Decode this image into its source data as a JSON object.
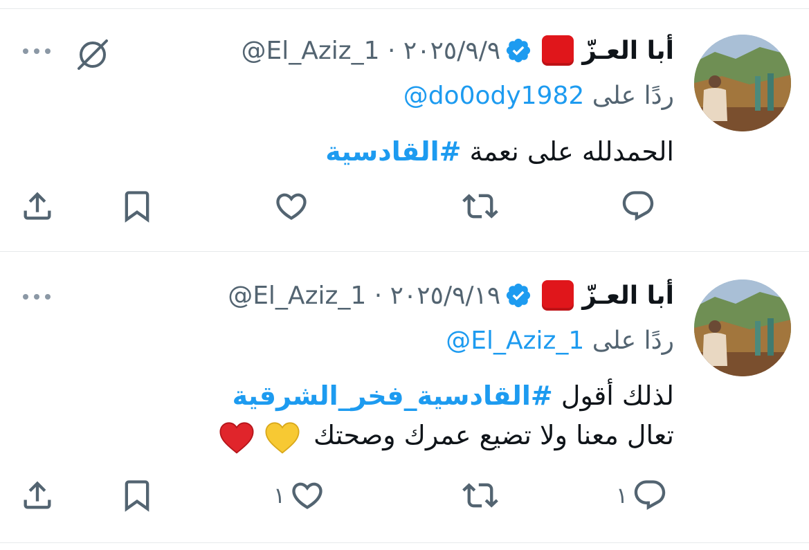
{
  "tweets": [
    {
      "display_name": "أبا العـزّ",
      "handle_date": "@El_Aziz_1 · ٢٠٢٥/٩/٩",
      "reply_prefix": "ردًا على",
      "reply_to": "@do0ody1982",
      "body_plain": "الحمدلله على نعمة ",
      "body_hashtag": "#القادسية",
      "line2_text": "",
      "reply_count": "",
      "like_count": ""
    },
    {
      "display_name": "أبا العـزّ",
      "handle_date": "@El_Aziz_1 · ٢٠٢٥/٩/١٩",
      "reply_prefix": "ردًا على",
      "reply_to": "@El_Aziz_1",
      "body_plain": "لذلك أقول ",
      "body_hashtag": "#القادسية_فخر_الشرقية",
      "line2_text": "تعال معنا ولا تضيع عمرك وصحتك",
      "reply_count": "١",
      "like_count": "١"
    }
  ],
  "icons": {
    "flag": "red-square-emoji",
    "verified": "verified-badge-icon",
    "more": "more-horizontal-icon",
    "grok": "grok-icon",
    "reply": "reply-icon",
    "retweet": "retweet-icon",
    "like": "heart-icon",
    "bookmark": "bookmark-icon",
    "share": "share-icon"
  },
  "colors": {
    "link": "#1d9bf0",
    "muted": "#536471",
    "text": "#0f1419",
    "flag": "#e0161b",
    "divider": "#e6e9eb"
  }
}
